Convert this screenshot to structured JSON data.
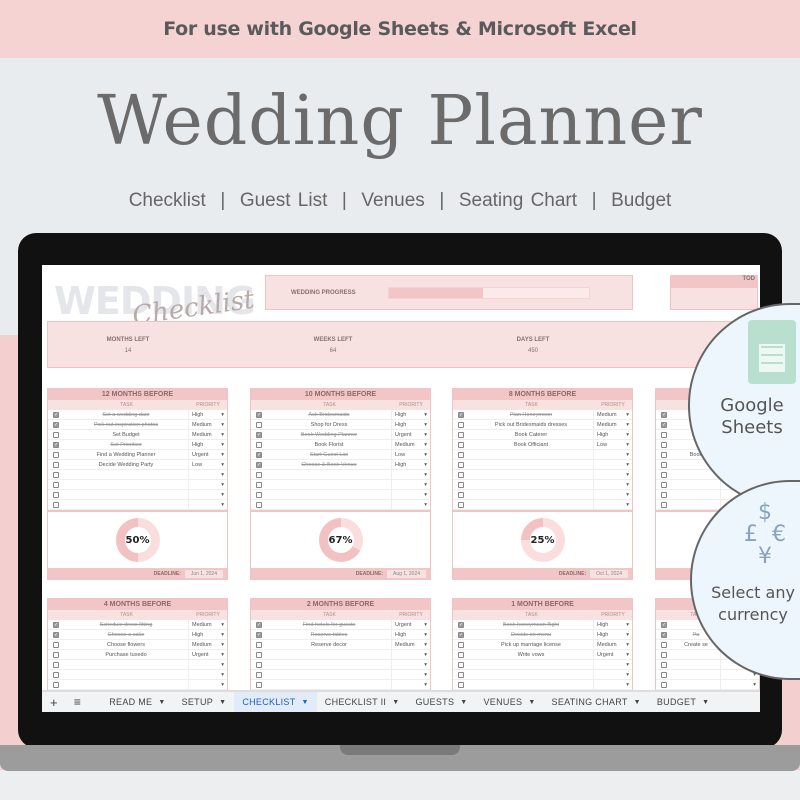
{
  "banner": "For use with Google Sheets & Microsoft Excel",
  "title": "Wedding Planner",
  "subtitle": "Checklist  |  Guest List  |  Venues  |  Seating Chart  |  Budget",
  "sheet": {
    "logo_main": "WEDDING",
    "logo_script": "Checklist",
    "progress_label": "WEDDING PROGRESS",
    "progress_value": 0.47,
    "today_label": "TOD",
    "stats": [
      {
        "label": "MONTHS LEFT",
        "value": "14"
      },
      {
        "label": "WEEKS LEFT",
        "value": "64"
      },
      {
        "label": "DAYS LEFT",
        "value": "450"
      }
    ],
    "task_header": "TASK",
    "priority_header": "PRIORITY",
    "deadline_label": "DEADLINE:",
    "tables": [
      {
        "title": "12 MONTHS BEFORE",
        "percent": "50%",
        "pct": 50,
        "deadline": "Jun 1, 2024",
        "rows": [
          {
            "done": true,
            "task": "Set a wedding date",
            "priority": "High"
          },
          {
            "done": true,
            "task": "Pick out inspiration photos",
            "priority": "Medium"
          },
          {
            "done": false,
            "task": "Set Budget",
            "priority": "Medium"
          },
          {
            "done": true,
            "task": "Set Priorities",
            "priority": "High"
          },
          {
            "done": false,
            "task": "Find a Wedding Planner",
            "priority": "Urgent"
          },
          {
            "done": false,
            "task": "Decide Wedding Party",
            "priority": "Low"
          }
        ]
      },
      {
        "title": "10 MONTHS BEFORE",
        "percent": "67%",
        "pct": 67,
        "deadline": "Aug 1, 2024",
        "rows": [
          {
            "done": true,
            "task": "Ask Bridesmaids",
            "priority": "High"
          },
          {
            "done": false,
            "task": "Shop for Dress",
            "priority": "High"
          },
          {
            "done": true,
            "task": "Book Wedding Planner",
            "priority": "Urgent"
          },
          {
            "done": false,
            "task": "Book Florist",
            "priority": "Medium"
          },
          {
            "done": true,
            "task": "Start Guest List",
            "priority": "Low"
          },
          {
            "done": true,
            "task": "Choose & Book Venue",
            "priority": "High"
          }
        ]
      },
      {
        "title": "8 MONTHS BEFORE",
        "percent": "25%",
        "pct": 25,
        "deadline": "Oct 1, 2024",
        "rows": [
          {
            "done": true,
            "task": "Plan Honeymoon",
            "priority": "Medium"
          },
          {
            "done": false,
            "task": "Pick out Bridesmaids dresses",
            "priority": "Medium"
          },
          {
            "done": false,
            "task": "Book Caterer",
            "priority": "High"
          },
          {
            "done": false,
            "task": "Book Officiant",
            "priority": "Low"
          }
        ]
      },
      {
        "title": "",
        "percent": "",
        "pct": 0,
        "deadline": "",
        "rows": [
          {
            "done": true,
            "task": "",
            "priority": ""
          },
          {
            "done": true,
            "task": "",
            "priority": ""
          },
          {
            "done": false,
            "task": "",
            "priority": ""
          },
          {
            "done": false,
            "task": "",
            "priority": ""
          },
          {
            "done": false,
            "task": "Book",
            "priority": ""
          }
        ]
      },
      {
        "title": "4 MONTHS BEFORE",
        "rows": [
          {
            "done": true,
            "task": "Schedule dress fitting",
            "priority": "Medium"
          },
          {
            "done": true,
            "task": "Choose a cake",
            "priority": "High"
          },
          {
            "done": false,
            "task": "Choose flowers",
            "priority": "Medium"
          },
          {
            "done": false,
            "task": "Purchase tuxedo",
            "priority": "Urgent"
          }
        ]
      },
      {
        "title": "2 MONTHS BEFORE",
        "rows": [
          {
            "done": true,
            "task": "Find hotels for guests",
            "priority": "Urgent"
          },
          {
            "done": true,
            "task": "Reserve tables",
            "priority": "High"
          },
          {
            "done": false,
            "task": "Reserve decor",
            "priority": "Medium"
          }
        ]
      },
      {
        "title": "1 MONTH BEFORE",
        "rows": [
          {
            "done": true,
            "task": "Book honeymoon flight",
            "priority": "High"
          },
          {
            "done": true,
            "task": "Decide on menu",
            "priority": "High"
          },
          {
            "done": false,
            "task": "Pick up marriage license",
            "priority": "Medium"
          },
          {
            "done": false,
            "task": "Write vows",
            "priority": "Urgent"
          }
        ]
      },
      {
        "title": "",
        "rows": [
          {
            "done": true,
            "task": "",
            "priority": ""
          },
          {
            "done": true,
            "task": "Pa",
            "priority": ""
          },
          {
            "done": false,
            "task": "Create se",
            "priority": ""
          }
        ]
      }
    ],
    "tabs": [
      {
        "label": "READ ME"
      },
      {
        "label": "SETUP"
      },
      {
        "label": "CHECKLIST",
        "active": true
      },
      {
        "label": "CHECKLIST II"
      },
      {
        "label": "GUESTS"
      },
      {
        "label": "VENUES"
      },
      {
        "label": "SEATING CHART"
      },
      {
        "label": "BUDGET"
      }
    ]
  },
  "badges": {
    "sheets": "Google Sheets",
    "currency_line1": "Select any",
    "currency_line2": "currency"
  },
  "colors": {
    "pink": "#f4cfcf",
    "header_pink": "#f2c6c6",
    "active_tab": "#1a63c7",
    "sheets_green": "#b9e0cf"
  }
}
